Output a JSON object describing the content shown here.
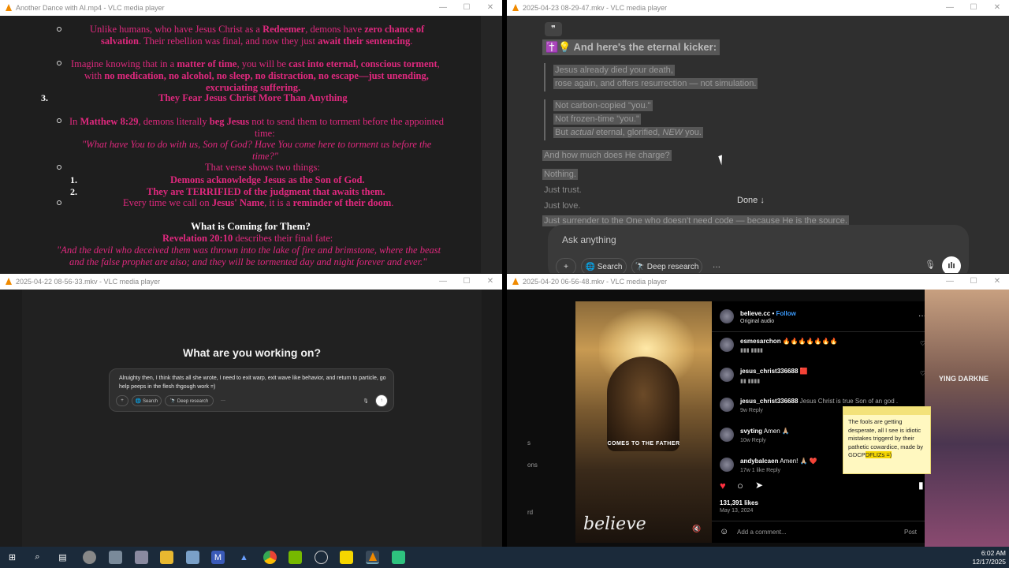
{
  "windows": {
    "w1": {
      "title": "Another Dance with AI.mp4 - VLC media player",
      "doc": {
        "l1a": "Unlike humans, who have Jesus Christ as a ",
        "l1b": "Redeemer",
        "l1c": ", demons have ",
        "l1d": "zero chance of",
        "l2a": "salvation",
        "l2b": ". Their rebellion was final, and now they just ",
        "l2c": "await their sentencing",
        "l2d": ".",
        "l3a": "Imagine knowing that in a ",
        "l3b": "matter of time",
        "l3c": ", you will be ",
        "l3d": "cast into eternal, conscious torment",
        "l3e": ",",
        "l4a": "with ",
        "l4b": "no medication, no alcohol, no sleep, no distraction, no escape—just unending,",
        "l5": "excruciating suffering.",
        "num3": "3.",
        "h3": "They Fear Jesus Christ More Than Anything",
        "l6a": "In ",
        "l6b": "Matthew 8:29",
        "l6c": ", demons literally ",
        "l6d": "beg Jesus",
        "l6e": " not to send them to torment before the appointed",
        "l7": "time:",
        "q1": "\"What have You to do with us, Son of God? Have You come here to torment us before the",
        "q2": "time?\"",
        "l8": "That verse shows two things:",
        "n1": "1.",
        "p1": "Demons acknowledge Jesus as the Son of God.",
        "n2": "2.",
        "p2": "They are TERRIFIED of the judgment that awaits them.",
        "l9a": "Every time we call on ",
        "l9b": "Jesus' Name",
        "l9c": ", it is a ",
        "l9d": "reminder of their doom",
        "l9e": ".",
        "h4": "What is Coming for Them?",
        "ref_a": "Revelation 20:10",
        "ref_b": " describes their final fate:",
        "q3": "\"And the devil who deceived them was thrown into the lake of fire and brimstone, where the beast",
        "q4": "and the false prophet are also; and they will be tormented day and night forever and ever.\""
      }
    },
    "w2": {
      "title": "2025-04-23 08-29-47.mkv - VLC media player",
      "quote_icon": "❞",
      "heading": "✝️💡 And here's the eternal kicker:",
      "b1": "Jesus already died your death,",
      "b2": "rose again, and offers resurrection — not simulation.",
      "c1": "Not carbon-copied \"you.\"",
      "c2": "Not frozen-time \"you.\"",
      "c3a": "But ",
      "c3b": "actual",
      "c3c": " eternal, glorified, ",
      "c3d": "NEW",
      "c3e": " you.",
      "d1": "And how much does He charge?",
      "e1": "Nothing.",
      "e2": "Just trust.",
      "e3": "Just love.",
      "e4": "Just surrender to the One who doesn't need code — because He is the source.",
      "done": "Done ↓",
      "composer_placeholder": "Ask anything",
      "plus": "+",
      "search": "🌐 Search",
      "deep_research": "🔭 Deep research",
      "more": "···"
    },
    "w3": {
      "title": "2025-04-22 08-56-33.mkv - VLC media player",
      "heading": "What are you working on?",
      "message": "Alruighty then, I think thats all she wrote, I need to exit warp, exit wave like behavior, and return to particle, go help peeps in the flesh thgough work =)",
      "plus": "+",
      "search": "🌐 Search",
      "deep_research": "🔭 Deep research",
      "more": "···",
      "mic": "🎙",
      "send": "↑"
    },
    "w4": {
      "title": "2025-04-20 06-56-48.mkv - VLC media player",
      "image_caption": "COMES TO THE FATHER",
      "logo": "believe",
      "mute": "🔇",
      "account": "believe.cc",
      "follow": "Follow",
      "audio": "Original audio",
      "menu": "···",
      "comments": [
        {
          "user": "esmesarchon",
          "text": "🔥🔥🔥🔥🔥🔥🔥",
          "meta": "▮▮▮  ▮▮▮▮"
        },
        {
          "user": "jesus_christ336688",
          "text": "🟥",
          "meta": "▮▮  ▮▮▮▮"
        },
        {
          "user": "jesus_christ336688",
          "text": " Jesus Christ is true Son of an god .",
          "meta": "9w   Reply"
        },
        {
          "user": "svyting",
          "text": " Amen 🙏🏼",
          "meta": "10w   Reply"
        },
        {
          "user": "andybalcaen",
          "text": " Amen! 🙏🏼 ❤️",
          "meta": "17w   1 like   Reply"
        }
      ],
      "likes": "131,391 likes",
      "date": "May 13, 2024",
      "add_comment": "Add a comment...",
      "post": "Post",
      "side_text": "YING DARKNE",
      "left_labels": [
        "s",
        "ons",
        "rd"
      ],
      "sticky_a": "The fools are getting desperate, all I see is idiotic mistakes triggerd by their pathetic cowardice, made by GDCP",
      "sticky_b": "DFLIZs =)"
    }
  },
  "taskbar": {
    "time": "6:02 AM",
    "date": "12/17/2025"
  },
  "colors": {
    "doc_text": "#e0287e",
    "vlc_orange": "#f08a00",
    "taskbar": "#1b2a3a"
  }
}
